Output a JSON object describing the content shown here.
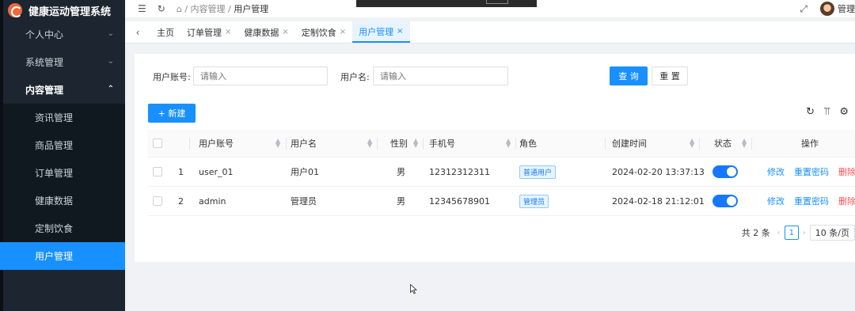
{
  "app": {
    "title": "健康运动管理系统"
  },
  "sidebar": {
    "items": [
      {
        "label": "个人中心",
        "arrow": "⌄"
      },
      {
        "label": "系统管理",
        "arrow": "⌄"
      },
      {
        "label": "内容管理",
        "arrow": "⌃"
      }
    ],
    "sub_items": [
      "资讯管理",
      "商品管理",
      "订单管理",
      "健康数据",
      "定制饮食",
      "用户管理"
    ],
    "active_sub": "用户管理"
  },
  "header": {
    "breadcrumb": {
      "home_icon": "home-icon",
      "level1": "内容管理",
      "sep": "/",
      "level2": "用户管理"
    },
    "user_label": "管理"
  },
  "tabs": [
    {
      "label": "主页",
      "closable": false
    },
    {
      "label": "订单管理",
      "closable": true
    },
    {
      "label": "健康数据",
      "closable": true
    },
    {
      "label": "定制饮食",
      "closable": true
    },
    {
      "label": "用户管理",
      "closable": true,
      "active": true
    }
  ],
  "search": {
    "account_label": "用户账号:",
    "account_placeholder": "请输入",
    "name_label": "用户名:",
    "name_placeholder": "请输入",
    "query_button": "查 询",
    "reset_button": "重 置"
  },
  "toolbar": {
    "new_button": "+ 新建"
  },
  "table": {
    "columns": [
      "用户账号",
      "用户名",
      "性别",
      "手机号",
      "角色",
      "创建时间",
      "状态",
      "操作"
    ],
    "rows": [
      {
        "index": "1",
        "account": "user_01",
        "name": "用户01",
        "gender": "男",
        "phone": "12312312311",
        "role": "普通用户",
        "created": "2024-02-20 13:37:13",
        "status": true,
        "ops": [
          "修改",
          "重置密码",
          "删除"
        ]
      },
      {
        "index": "2",
        "account": "admin",
        "name": "管理员",
        "gender": "男",
        "phone": "12345678901",
        "role": "管理员",
        "created": "2024-02-18 21:12:01",
        "status": true,
        "ops": [
          "修改",
          "重置密码",
          "删除"
        ]
      }
    ]
  },
  "pagination": {
    "total": "共 2 条",
    "current_page": "1",
    "page_size": "10 条/页"
  },
  "colors": {
    "primary": "#1890ff",
    "danger": "#ff4d4f",
    "sidebar": "#1d2630"
  }
}
